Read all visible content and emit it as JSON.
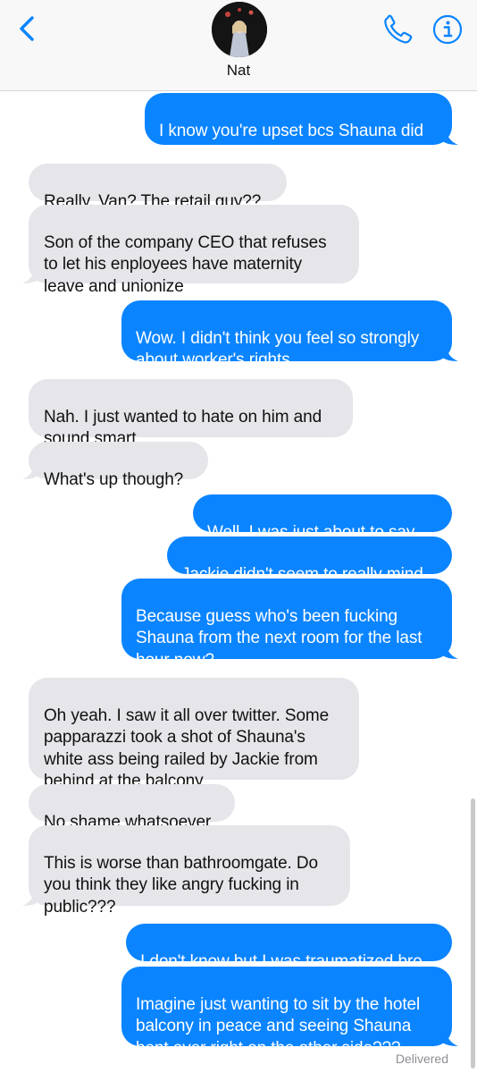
{
  "header": {
    "contact_name": "Nat"
  },
  "icons": {
    "back": "chevron-left-icon",
    "phone": "phone-icon",
    "info": "info-circle-icon"
  },
  "colors": {
    "accent": "#0a84ff",
    "incoming_bubble": "#e5e5ea",
    "header_bg": "#f8f8f8"
  },
  "messages": [
    {
      "dir": "out",
      "text": "I know you're upset bcs Shauna did\nJackie really dirty with the Jeff stuff"
    },
    {
      "dir": "in",
      "text": "Really, Van? The retail guy??"
    },
    {
      "dir": "in",
      "text": "Son of the company CEO that refuses\nto let his enployees have maternity\nleave and unionize"
    },
    {
      "dir": "out",
      "text": "Wow. I didn't think you feel so strongly\nabout worker's rights"
    },
    {
      "dir": "in",
      "text": "Nah. I just wanted to hate on him and\nsound smart"
    },
    {
      "dir": "in",
      "text": "What's up though?"
    },
    {
      "dir": "out",
      "text": "Well, I was just about to say..."
    },
    {
      "dir": "out",
      "text": "Jackie didn't seem to really mind"
    },
    {
      "dir": "out",
      "text": "Because guess who's been fucking\nShauna from the next room for the last\nhour now?"
    },
    {
      "dir": "in",
      "text": "Oh yeah. I saw it all over twitter. Some\npapparazzi took a shot of Shauna's\nwhite ass being railed by Jackie from\nbehind at the balcony"
    },
    {
      "dir": "in",
      "text": "No shame whatsoever"
    },
    {
      "dir": "in",
      "text": "This is worse than bathroomgate. Do\nyou think they like angry fucking in\npublic???"
    },
    {
      "dir": "out",
      "text": "I don't know but I was traumatized bro"
    },
    {
      "dir": "out",
      "text": "Imagine just wanting to sit by the hotel\nbalcony in peace and seeing Shauna\nbent over right on the other side???"
    }
  ],
  "status": {
    "delivered": "Delivered"
  }
}
